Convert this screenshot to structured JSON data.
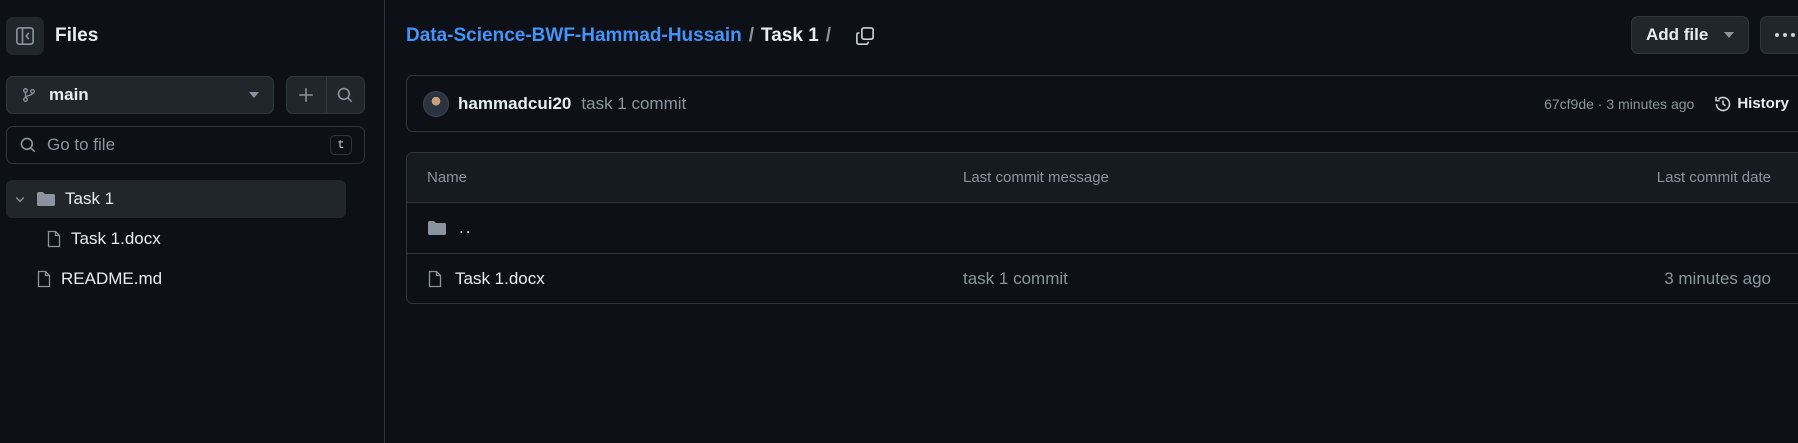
{
  "sidebar": {
    "title": "Files",
    "branch": "main",
    "search_placeholder": "Go to file",
    "search_shortcut": "t",
    "tree": [
      {
        "label": "Task 1",
        "type": "folder",
        "expanded": true
      },
      {
        "label": "Task 1.docx",
        "type": "file"
      },
      {
        "label": "README.md",
        "type": "file"
      }
    ]
  },
  "header": {
    "repo": "Data-Science-BWF-Hammad-Hussain",
    "separator": "/",
    "current": "Task 1",
    "trailing_separator": "/",
    "add_file_label": "Add file"
  },
  "commit": {
    "author": "hammadcui20",
    "message": "task 1 commit",
    "meta": "67cf9de · 3 minutes ago",
    "history_label": "History"
  },
  "table": {
    "headers": {
      "name": "Name",
      "message": "Last commit message",
      "date": "Last commit date"
    },
    "parent_dir": "..",
    "rows": [
      {
        "name": "Task 1.docx",
        "message": "task 1 commit",
        "date": "3 minutes ago"
      }
    ]
  },
  "colors": {
    "background": "#0d1117",
    "border": "#30363d",
    "link": "#4493f8",
    "muted": "#8b949e"
  }
}
